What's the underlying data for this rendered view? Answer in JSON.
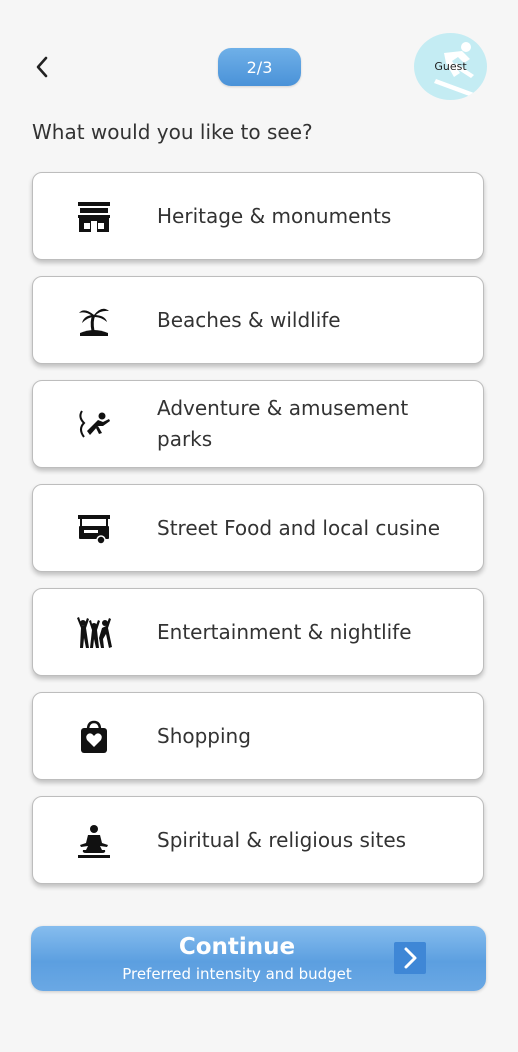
{
  "header": {
    "back_icon": "chevron-left-icon",
    "step": "2/3",
    "avatar_label": "Guest",
    "avatar_icon": "skier-icon"
  },
  "question": "What would you like to see?",
  "options": [
    {
      "label": "Heritage & monuments",
      "icon": "monument-icon"
    },
    {
      "label": "Beaches & wildlife",
      "icon": "palm-island-icon"
    },
    {
      "label": "Adventure & amusement parks",
      "icon": "bungee-jump-icon"
    },
    {
      "label": "Street Food and local cusine",
      "icon": "food-cart-icon"
    },
    {
      "label": "Entertainment & nightlife",
      "icon": "dancing-people-icon"
    },
    {
      "label": "Shopping",
      "icon": "shopping-bag-heart-icon"
    },
    {
      "label": "Spiritual & religious sites",
      "icon": "meditation-icon"
    }
  ],
  "continue": {
    "title": "Continue",
    "subtitle": "Preferred intensity and budget",
    "arrow_icon": "chevron-right-icon"
  },
  "colors": {
    "accent": "#5c9fe0",
    "avatar_bg": "#c4ecf3",
    "background": "#f6f6f6"
  }
}
